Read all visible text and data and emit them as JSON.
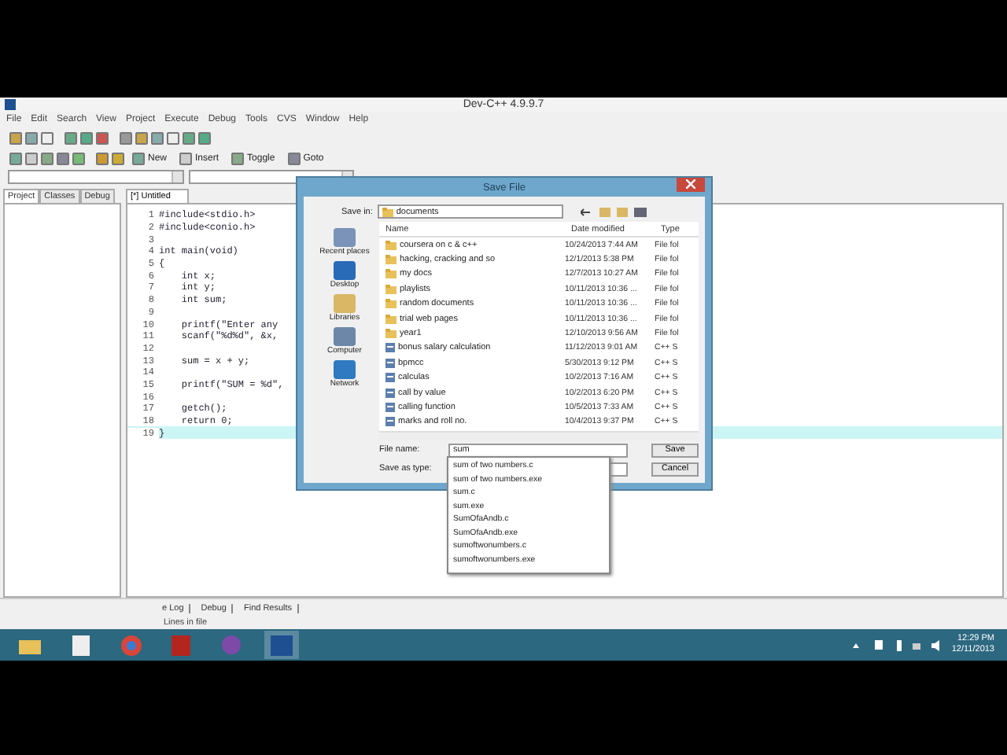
{
  "window": {
    "title": "Dev-C++ 4.9.9.7"
  },
  "menu": [
    "File",
    "Edit",
    "Search",
    "View",
    "Project",
    "Execute",
    "Debug",
    "Tools",
    "CVS",
    "Window",
    "Help"
  ],
  "toolbar_buttons": [
    "New",
    "Insert",
    "Toggle",
    "Goto"
  ],
  "side_tabs": [
    {
      "label": "Project",
      "selected": true
    },
    {
      "label": "Classes",
      "selected": false
    },
    {
      "label": "Debug",
      "selected": false
    }
  ],
  "editor": {
    "tab": "[*] Untitled",
    "lines": [
      {
        "number": "1",
        "code": "#include<stdio.h>",
        "current": false
      },
      {
        "number": "2",
        "code": "#include<conio.h>",
        "current": false
      },
      {
        "number": "3",
        "current": false
      },
      {
        "number": "4",
        "code": "int main(void)",
        "current": false
      },
      {
        "number": "5",
        "code": "{",
        "current": false
      },
      {
        "number": "6",
        "code": "    int x;",
        "current": false
      },
      {
        "number": "7",
        "code": "    int y;",
        "current": false
      },
      {
        "number": "8",
        "code": "    int sum;",
        "current": false
      },
      {
        "number": "9",
        "current": false
      },
      {
        "number": "10",
        "code": "    printf(\"Enter any",
        "current": false
      },
      {
        "number": "11",
        "code": "    scanf(\"%d%d\", &x,",
        "current": false
      },
      {
        "number": "12",
        "current": false
      },
      {
        "number": "13",
        "code": "    sum = x + y;",
        "current": false
      },
      {
        "number": "14",
        "current": false
      },
      {
        "number": "15",
        "code": "    printf(\"SUM = %d\",",
        "current": false
      },
      {
        "number": "16",
        "current": false
      },
      {
        "number": "17",
        "code": "    getch();",
        "current": false
      },
      {
        "number": "18",
        "code": "    return 0;",
        "current": false
      },
      {
        "number": "19",
        "code": "}",
        "current": true
      }
    ]
  },
  "dialog": {
    "title": "Save File",
    "save_in_label": "Save in:",
    "save_in": "documents",
    "places": [
      "Recent places",
      "Desktop",
      "Libraries",
      "Computer",
      "Network"
    ],
    "columns": [
      "Name",
      "Date modified",
      "Type"
    ],
    "files": [
      {
        "name": "coursera on c & c++",
        "date": "10/24/2013 7:44 AM",
        "type": "File fol",
        "kind": "folder"
      },
      {
        "name": "hacking, cracking and so",
        "date": "12/1/2013 5:38 PM",
        "type": "File fol",
        "kind": "folder"
      },
      {
        "name": "my docs",
        "date": "12/7/2013 10:27 AM",
        "type": "File fol",
        "kind": "folder"
      },
      {
        "name": "playlists",
        "date": "10/11/2013 10:36 ...",
        "type": "File fol",
        "kind": "folder"
      },
      {
        "name": "random documents",
        "date": "10/11/2013 10:36 ...",
        "type": "File fol",
        "kind": "folder"
      },
      {
        "name": "trial web pages",
        "date": "10/11/2013 10:36 ...",
        "type": "File fol",
        "kind": "folder"
      },
      {
        "name": "year1",
        "date": "12/10/2013 9:56 AM",
        "type": "File fol",
        "kind": "folder"
      },
      {
        "name": "bonus salary calculation",
        "date": "11/12/2013 9:01 AM",
        "type": "C++ S",
        "kind": "file"
      },
      {
        "name": "bpmcc",
        "date": "5/30/2013 9:12 PM",
        "type": "C++ S",
        "kind": "file"
      },
      {
        "name": "calculas",
        "date": "10/2/2013 7:16 AM",
        "type": "C++ S",
        "kind": "file"
      },
      {
        "name": "call by value",
        "date": "10/2/2013 6:20 PM",
        "type": "C++ S",
        "kind": "file"
      },
      {
        "name": "calling function",
        "date": "10/5/2013 7:33 AM",
        "type": "C++ S",
        "kind": "file"
      },
      {
        "name": "marks and roll no.",
        "date": "10/4/2013 9:37 PM",
        "type": "C++ S",
        "kind": "file"
      }
    ],
    "file_name_label": "File name:",
    "file_name": "sum",
    "save_type_label": "Save as type:",
    "buttons": [
      "Save",
      "Cancel"
    ],
    "suggestions": [
      "sum of two numbers.c",
      "sum of two numbers.exe",
      "sum.c",
      "sum.exe",
      "SumOfaAndb.c",
      "SumOfaAndb.exe",
      "sumoftwonumbers.c",
      "sumoftwonumbers.exe"
    ]
  },
  "bottom_tabs": [
    "e Log",
    "Debug",
    "Find Results"
  ],
  "status_bar": "Lines in file",
  "taskbar": {
    "time": "12:29 PM",
    "date": "12/11/2013"
  }
}
